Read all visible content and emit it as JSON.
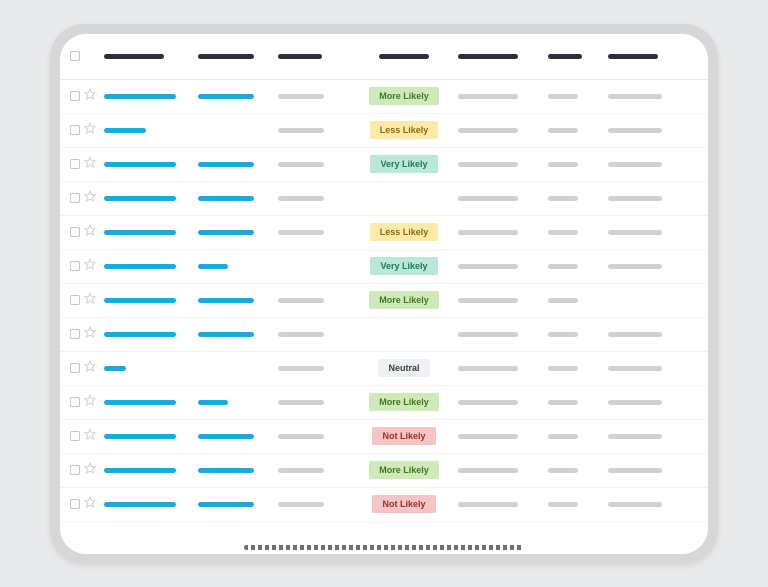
{
  "header": {
    "cols": [
      {
        "w": 60
      },
      {
        "w": 56
      },
      {
        "w": 44
      },
      {
        "w": 50
      },
      {
        "w": 60
      },
      {
        "w": 34
      },
      {
        "w": 50
      }
    ]
  },
  "badgeStyles": {
    "More Likely": "b-more",
    "Less Likely": "b-less",
    "Very Likely": "b-very",
    "Neutral": "b-neutral",
    "Not Likely": "b-not"
  },
  "rows": [
    {
      "l1": 72,
      "l2": 56,
      "g3": 46,
      "badge": "More Likely",
      "g5": 60,
      "g6": 30,
      "g7": 54
    },
    {
      "l1": 42,
      "l2": 0,
      "g3": 46,
      "badge": "Less Likely",
      "g5": 60,
      "g6": 30,
      "g7": 54
    },
    {
      "l1": 72,
      "l2": 56,
      "g3": 46,
      "badge": "Very Likely",
      "g5": 60,
      "g6": 30,
      "g7": 54
    },
    {
      "l1": 72,
      "l2": 56,
      "g3": 46,
      "badge": "",
      "g5": 60,
      "g6": 30,
      "g7": 54
    },
    {
      "l1": 72,
      "l2": 56,
      "g3": 46,
      "badge": "Less Likely",
      "g5": 60,
      "g6": 30,
      "g7": 54
    },
    {
      "l1": 72,
      "l2": 30,
      "g3": 0,
      "badge": "Very Likely",
      "g5": 60,
      "g6": 30,
      "g7": 54
    },
    {
      "l1": 72,
      "l2": 56,
      "g3": 46,
      "badge": "More Likely",
      "g5": 60,
      "g6": 30,
      "g7": 0
    },
    {
      "l1": 72,
      "l2": 56,
      "g3": 46,
      "badge": "",
      "g5": 60,
      "g6": 30,
      "g7": 54
    },
    {
      "l1": 22,
      "l2": 0,
      "g3": 46,
      "badge": "Neutral",
      "g5": 60,
      "g6": 30,
      "g7": 54
    },
    {
      "l1": 72,
      "l2": 30,
      "g3": 46,
      "badge": "More Likely",
      "g5": 60,
      "g6": 30,
      "g7": 54
    },
    {
      "l1": 72,
      "l2": 56,
      "g3": 46,
      "badge": "Not Likely",
      "g5": 60,
      "g6": 30,
      "g7": 54
    },
    {
      "l1": 72,
      "l2": 56,
      "g3": 46,
      "badge": "More Likely",
      "g5": 60,
      "g6": 30,
      "g7": 54
    },
    {
      "l1": 72,
      "l2": 56,
      "g3": 46,
      "badge": "Not Likely",
      "g5": 60,
      "g6": 30,
      "g7": 54
    }
  ]
}
